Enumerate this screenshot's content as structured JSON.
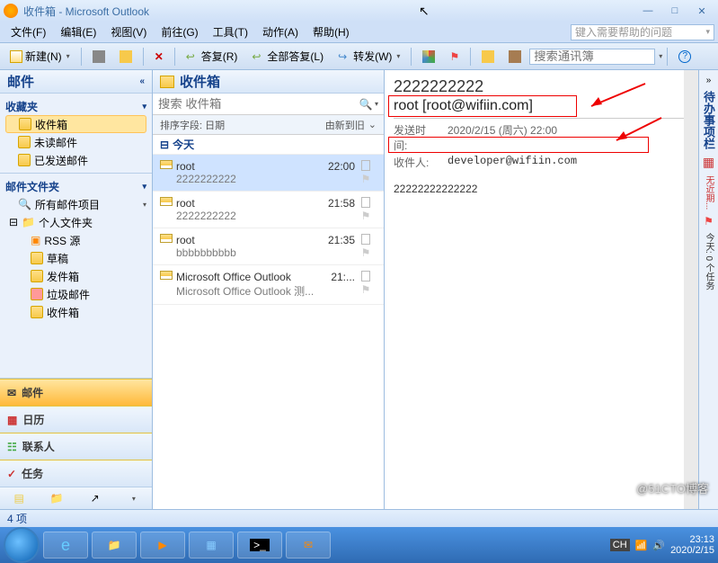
{
  "title": "收件箱 - Microsoft Outlook",
  "menus": [
    "文件(F)",
    "编辑(E)",
    "视图(V)",
    "前往(G)",
    "工具(T)",
    "动作(A)",
    "帮助(H)"
  ],
  "help_placeholder": "键入需要帮助的问题",
  "toolbar": {
    "new": "新建(N)",
    "reply": "答复(R)",
    "reply_all": "全部答复(L)",
    "forward": "转发(W)",
    "search_contacts": "搜索通讯簿"
  },
  "nav": {
    "header": "邮件",
    "fav_title": "收藏夹",
    "fav_items": [
      "收件箱",
      "未读邮件",
      "已发送邮件"
    ],
    "folders_title": "邮件文件夹",
    "all_items": "所有邮件项目",
    "personal": "个人文件夹",
    "personal_items": [
      "RSS 源",
      "草稿",
      "发件箱",
      "垃圾邮件",
      "收件箱"
    ],
    "big": {
      "mail": "邮件",
      "calendar": "日历",
      "contacts": "联系人",
      "tasks": "任务"
    }
  },
  "list": {
    "header": "收件箱",
    "search_placeholder": "搜索 收件箱",
    "sort_label": "排序字段: 日期",
    "sort_order": "由新到旧",
    "group": "今天",
    "items": [
      {
        "from": "root",
        "subj": "2222222222",
        "time": "22:00",
        "selected": true
      },
      {
        "from": "root",
        "subj": "2222222222",
        "time": "21:58"
      },
      {
        "from": "root",
        "subj": "bbbbbbbbbb",
        "time": "21:35"
      },
      {
        "from": "Microsoft Office Outlook",
        "subj": "Microsoft Office Outlook 测...",
        "time": "21:..."
      }
    ]
  },
  "reading": {
    "subject": "2222222222",
    "from": "root [root@wifiin.com]",
    "sent_label": "发送时间:",
    "sent": "2020/2/15 (周六) 22:00",
    "to_label": "收件人:",
    "to": "developer@wifiin.com",
    "body": "22222222222222"
  },
  "todo": {
    "title": "待办事项栏",
    "line1": "无近期...",
    "line2": "今天: 0 个任务"
  },
  "status": "4 项",
  "tray": {
    "ime": "CH",
    "time": "23:13",
    "date": "2020/2/15"
  },
  "watermark": "@51CTO博客"
}
